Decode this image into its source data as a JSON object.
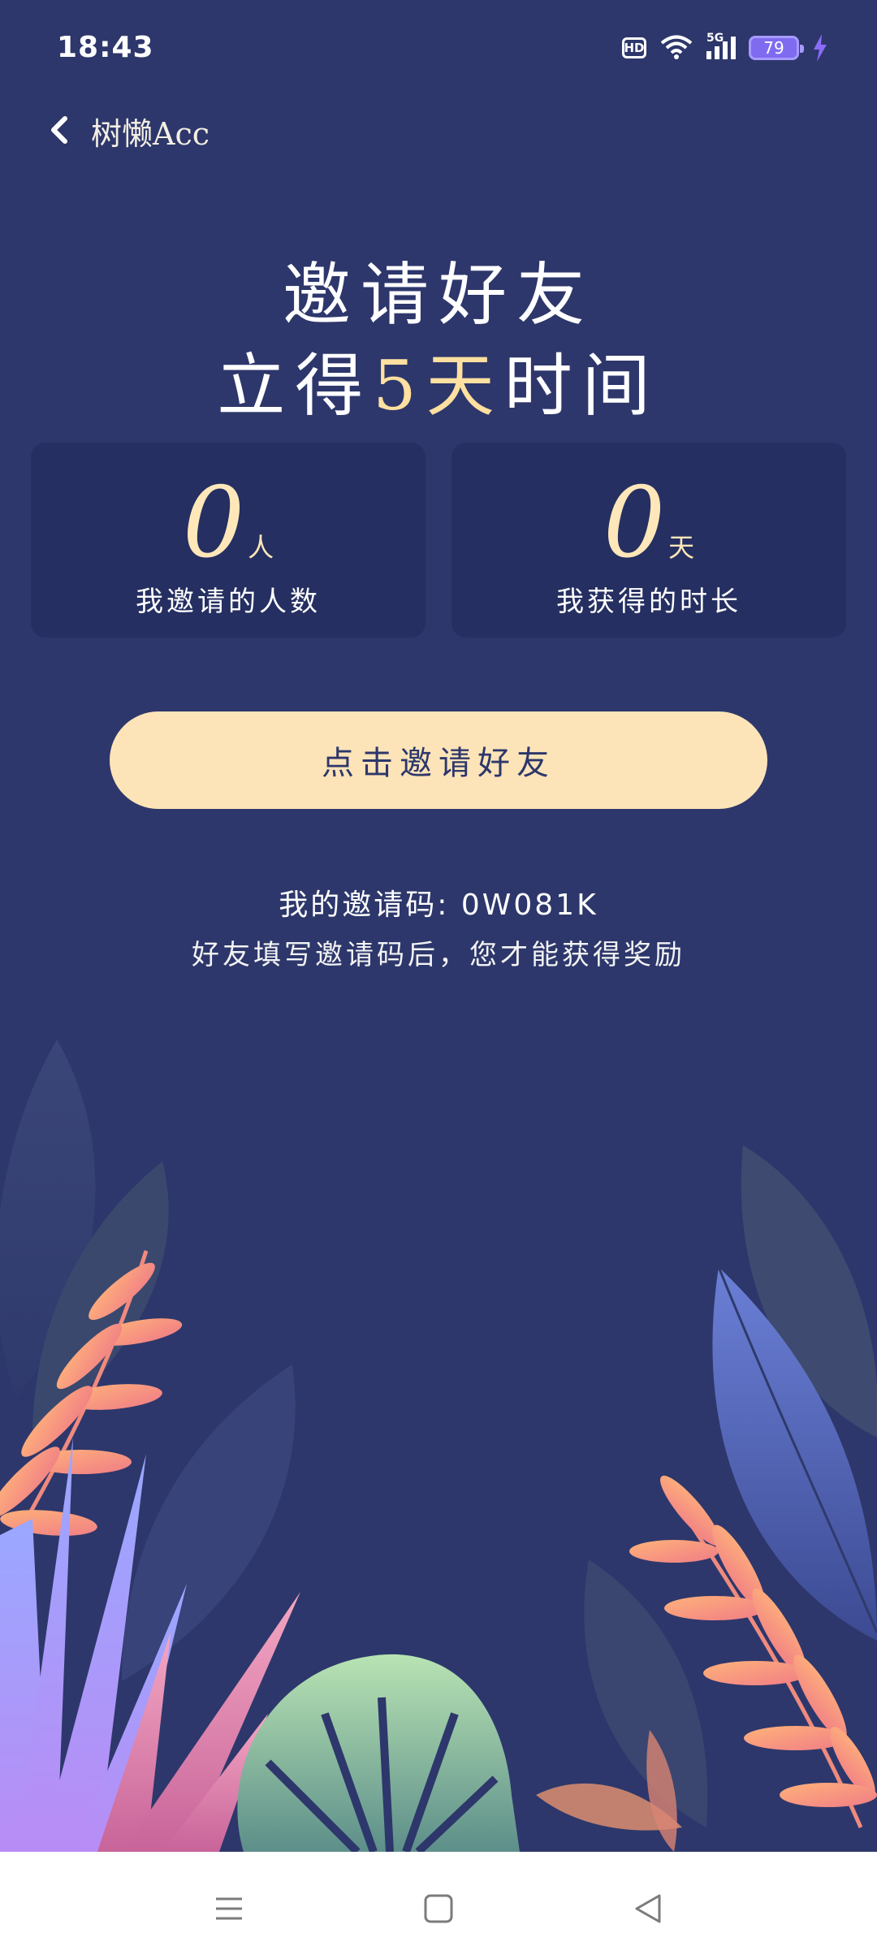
{
  "status_bar": {
    "time": "18:43",
    "hd": "HD",
    "network": "5G",
    "battery": "79",
    "icons": [
      "hd-icon",
      "wifi-icon",
      "signal-icon",
      "battery-icon",
      "charging-icon"
    ]
  },
  "nav": {
    "title": "树懒Acc",
    "back_icon": "chevron-left-icon"
  },
  "headline": {
    "line1": "邀请好友",
    "line2_prefix": "立得",
    "line2_highlight": "5天",
    "line2_suffix": "时间"
  },
  "stats": [
    {
      "value": "0",
      "unit": "人",
      "label": "我邀请的人数"
    },
    {
      "value": "0",
      "unit": "天",
      "label": "我获得的时长"
    }
  ],
  "invite_button_label": "点击邀请好友",
  "invite_code_label": "我的邀请码: 0W081K",
  "invite_note": "好友填写邀请码后，您才能获得奖励",
  "system_nav": {
    "icons": [
      "menu-icon",
      "home-icon",
      "back-triangle-icon"
    ]
  },
  "colors": {
    "background": "#2d376b",
    "card": "#252f61",
    "accent": "#ffe0a0",
    "button": "#fde4b8"
  }
}
